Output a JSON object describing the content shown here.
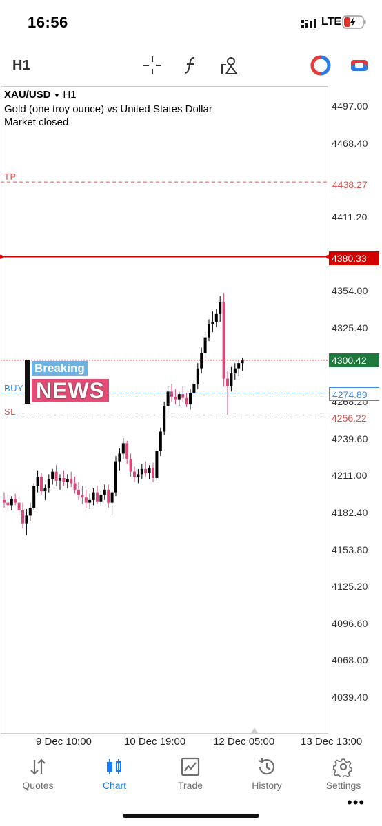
{
  "status_bar": {
    "time": "16:56",
    "network": "LTE"
  },
  "toolbar": {
    "timeframe": "H1",
    "icons": [
      "crosshair-icon",
      "indicator-icon",
      "objects-icon",
      "one-click-trading-icon",
      "trade-button-icon"
    ]
  },
  "chart": {
    "symbol": "XAU/USD",
    "timeframe": "H1",
    "description": "Gold (one troy ounce) vs United States Dollar",
    "market_status": "Market closed",
    "price_axis": [
      "4497.00",
      "4468.40",
      "4438.27",
      "4411.20",
      "4380.33",
      "4354.00",
      "4325.40",
      "4300.42",
      "4274.89",
      "4268.20",
      "4256.22",
      "4239.60",
      "4211.00",
      "4182.40",
      "4153.80",
      "4125.20",
      "4096.60",
      "4068.00",
      "4039.40"
    ],
    "tp": {
      "label": "TP",
      "price": "4438.27"
    },
    "buy": {
      "label": "BUY",
      "price": "4274.89"
    },
    "sl": {
      "label": "SL",
      "price": "4256.22"
    },
    "alert_price": "4380.33",
    "bid_price": "4300.42",
    "time_axis": [
      "9 Dec 10:00",
      "10 Dec 19:00",
      "12 Dec 05:00",
      "13 Dec 13:00"
    ],
    "overlay": {
      "top": "Breaking",
      "bottom": "NEWS"
    },
    "more_label": "•••",
    "colors": {
      "bull": "#000000",
      "bear": "#d9487a",
      "tp_sl": "#d9534f",
      "buy": "#3a8ee6",
      "alert": "#d40000"
    }
  },
  "chart_data": {
    "type": "candlestick",
    "symbol": "XAU/USD",
    "ylim": [
      4030,
      4510
    ],
    "candles": [
      [
        4192,
        4198,
        4186,
        4190
      ],
      [
        4190,
        4196,
        4183,
        4188
      ],
      [
        4188,
        4195,
        4184,
        4193
      ],
      [
        4193,
        4197,
        4188,
        4190
      ],
      [
        4190,
        4194,
        4180,
        4184
      ],
      [
        4184,
        4190,
        4170,
        4174
      ],
      [
        4174,
        4185,
        4165,
        4180
      ],
      [
        4180,
        4190,
        4176,
        4186
      ],
      [
        4186,
        4205,
        4184,
        4203
      ],
      [
        4203,
        4215,
        4198,
        4210
      ],
      [
        4210,
        4213,
        4196,
        4199
      ],
      [
        4199,
        4204,
        4192,
        4201
      ],
      [
        4201,
        4212,
        4198,
        4208
      ],
      [
        4208,
        4216,
        4204,
        4214
      ],
      [
        4214,
        4219,
        4203,
        4207
      ],
      [
        4207,
        4212,
        4200,
        4209
      ],
      [
        4209,
        4215,
        4203,
        4206
      ],
      [
        4206,
        4212,
        4201,
        4208
      ],
      [
        4208,
        4214,
        4202,
        4205
      ],
      [
        4205,
        4210,
        4197,
        4200
      ],
      [
        4200,
        4206,
        4192,
        4196
      ],
      [
        4196,
        4203,
        4189,
        4194
      ],
      [
        4194,
        4200,
        4186,
        4190
      ],
      [
        4190,
        4197,
        4185,
        4192
      ],
      [
        4192,
        4201,
        4188,
        4198
      ],
      [
        4198,
        4203,
        4189,
        4191
      ],
      [
        4191,
        4199,
        4187,
        4196
      ],
      [
        4196,
        4204,
        4192,
        4200
      ],
      [
        4200,
        4204,
        4186,
        4190
      ],
      [
        4190,
        4200,
        4180,
        4198
      ],
      [
        4198,
        4226,
        4195,
        4222
      ],
      [
        4222,
        4232,
        4215,
        4228
      ],
      [
        4228,
        4240,
        4224,
        4236
      ],
      [
        4236,
        4238,
        4220,
        4224
      ],
      [
        4224,
        4228,
        4210,
        4214
      ],
      [
        4214,
        4218,
        4206,
        4210
      ],
      [
        4210,
        4216,
        4205,
        4212
      ],
      [
        4212,
        4220,
        4208,
        4216
      ],
      [
        4216,
        4222,
        4210,
        4213
      ],
      [
        4213,
        4219,
        4208,
        4217
      ],
      [
        4217,
        4221,
        4206,
        4209
      ],
      [
        4209,
        4232,
        4207,
        4230
      ],
      [
        4230,
        4248,
        4226,
        4245
      ],
      [
        4245,
        4268,
        4242,
        4265
      ],
      [
        4265,
        4280,
        4260,
        4276
      ],
      [
        4276,
        4282,
        4268,
        4272
      ],
      [
        4272,
        4278,
        4266,
        4270
      ],
      [
        4270,
        4276,
        4265,
        4274
      ],
      [
        4274,
        4280,
        4268,
        4271
      ],
      [
        4271,
        4275,
        4264,
        4266
      ],
      [
        4266,
        4278,
        4262,
        4275
      ],
      [
        4275,
        4285,
        4272,
        4282
      ],
      [
        4282,
        4298,
        4278,
        4294
      ],
      [
        4294,
        4310,
        4290,
        4306
      ],
      [
        4306,
        4322,
        4302,
        4318
      ],
      [
        4318,
        4332,
        4315,
        4328
      ],
      [
        4328,
        4338,
        4322,
        4330
      ],
      [
        4330,
        4340,
        4326,
        4336
      ],
      [
        4336,
        4350,
        4330,
        4345
      ],
      [
        4345,
        4352,
        4280,
        4286
      ],
      [
        4286,
        4292,
        4258,
        4280
      ],
      [
        4280,
        4295,
        4276,
        4290
      ],
      [
        4290,
        4298,
        4285,
        4294
      ],
      [
        4294,
        4300,
        4288,
        4298
      ],
      [
        4298,
        4302,
        4292,
        4300
      ]
    ],
    "levels": {
      "TP": 4438.27,
      "alert": 4380.33,
      "bid": 4300.42,
      "BUY": 4274.89,
      "SL": 4256.22
    }
  },
  "nav": {
    "items": [
      {
        "label": "Quotes",
        "icon": "quotes-icon"
      },
      {
        "label": "Chart",
        "icon": "chart-icon"
      },
      {
        "label": "Trade",
        "icon": "trade-icon"
      },
      {
        "label": "History",
        "icon": "history-icon"
      },
      {
        "label": "Settings",
        "icon": "settings-icon"
      }
    ],
    "active": "Chart"
  }
}
